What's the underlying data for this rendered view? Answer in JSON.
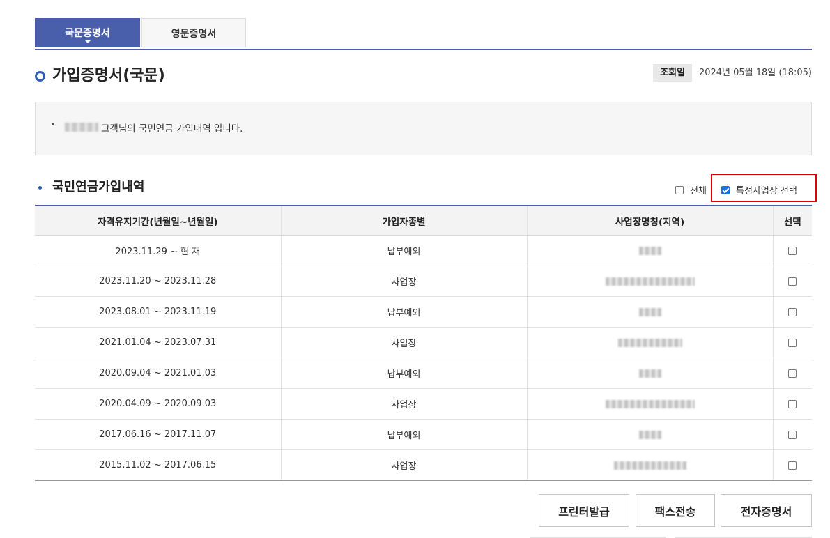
{
  "tabs": [
    {
      "label": "국문증명서",
      "active": true
    },
    {
      "label": "영문증명서",
      "active": false
    }
  ],
  "page_title": "가입증명서(국문)",
  "view_info": {
    "label": "조회일",
    "date": "2024년 05월 18일 (18:05)"
  },
  "notice": {
    "text": "고객님의 국민연금 가입내역 입니다."
  },
  "section": {
    "title": "국민연금가입내역",
    "checkbox_all": {
      "label": "전체",
      "checked": false
    },
    "checkbox_specific": {
      "label": "특정사업장 선택",
      "checked": true
    }
  },
  "table": {
    "headers": [
      "자격유지기간(년월일~년월일)",
      "가입자종별",
      "사업장명칭(지역)",
      "선택"
    ],
    "rows": [
      {
        "period": "2023.11.29 ~ 현 재",
        "type": "납부예외",
        "checked": false
      },
      {
        "period": "2023.11.20 ~ 2023.11.28",
        "type": "사업장",
        "checked": false
      },
      {
        "period": "2023.08.01 ~ 2023.11.19",
        "type": "납부예외",
        "checked": false
      },
      {
        "period": "2021.01.04 ~ 2023.07.31",
        "type": "사업장",
        "checked": false
      },
      {
        "period": "2020.09.04 ~ 2021.01.03",
        "type": "납부예외",
        "checked": false
      },
      {
        "period": "2020.04.09 ~ 2020.09.03",
        "type": "사업장",
        "checked": false
      },
      {
        "period": "2017.06.16 ~ 2017.11.07",
        "type": "납부예외",
        "checked": false
      },
      {
        "period": "2015.11.02 ~ 2017.06.15",
        "type": "사업장",
        "checked": false
      }
    ]
  },
  "buttons": {
    "print": "프린터발급",
    "fax": "팩스전송",
    "ecert": "전자증명서"
  },
  "colors": {
    "accent": "#4a5fab",
    "title_dot": "#2c5fb3",
    "highlight": "#e00000"
  }
}
